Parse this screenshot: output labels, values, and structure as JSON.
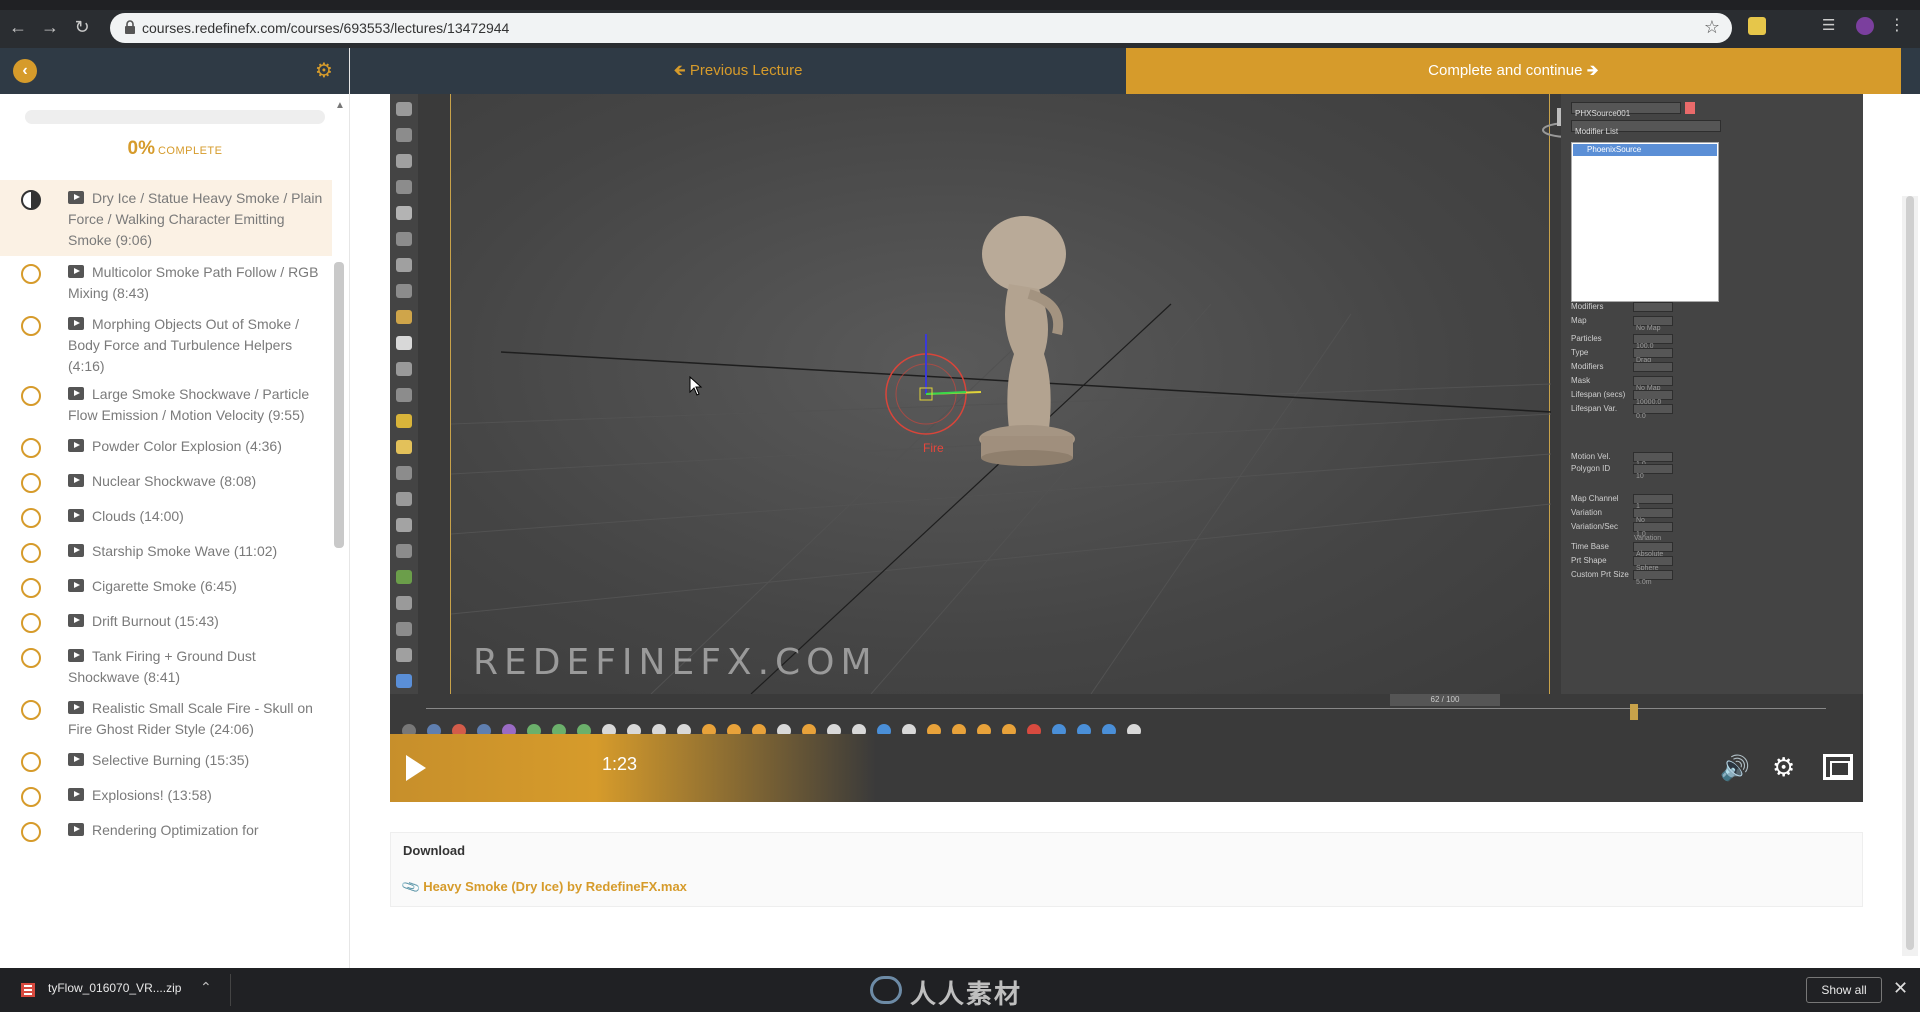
{
  "browser": {
    "url": "courses.redefinefx.com/courses/693553/lectures/13472944"
  },
  "sidebar": {
    "progress_percent": "0%",
    "progress_word": "COMPLETE",
    "progress_value": 0,
    "lectures": [
      {
        "title": "Dry Ice / Statue Heavy Smoke / Plain Force / Walking Character Emitting Smoke (9:06)",
        "status": "current"
      },
      {
        "title": "Multicolor Smoke Path Follow / RGB Mixing (8:43)",
        "status": "incomplete"
      },
      {
        "title": "Morphing Objects Out of Smoke / Body Force and Turbulence Helpers (4:16)",
        "status": "incomplete"
      },
      {
        "title": "Large Smoke Shockwave / Particle Flow Emission / Motion Velocity (9:55)",
        "status": "incomplete"
      },
      {
        "title": "Powder Color Explosion (4:36)",
        "status": "incomplete"
      },
      {
        "title": "Nuclear Shockwave (8:08)",
        "status": "incomplete"
      },
      {
        "title": "Clouds (14:00)",
        "status": "incomplete"
      },
      {
        "title": "Starship Smoke Wave (11:02)",
        "status": "incomplete"
      },
      {
        "title": "Cigarette Smoke (6:45)",
        "status": "incomplete"
      },
      {
        "title": "Drift Burnout (15:43)",
        "status": "incomplete"
      },
      {
        "title": "Tank Firing + Ground Dust Shockwave (8:41)",
        "status": "incomplete"
      },
      {
        "title": "Realistic Small Scale Fire - Skull on Fire Ghost Rider Style (24:06)",
        "status": "incomplete"
      },
      {
        "title": "Selective Burning (15:35)",
        "status": "incomplete"
      },
      {
        "title": "Explosions! (13:58)",
        "status": "incomplete"
      },
      {
        "title": "Rendering Optimization for",
        "status": "incomplete"
      }
    ]
  },
  "course_nav": {
    "previous_label": "Previous Lecture",
    "complete_label": "Complete and continue"
  },
  "video": {
    "watermark": "REDEFINEFX.COM",
    "time": "1:23",
    "fire_label": "Fire",
    "frame_indicator": "62 / 100",
    "panel": {
      "object_name": "PHXSource001",
      "modifier_list": "Modifier List",
      "selected_modifier": "PhoenixSource",
      "rows": [
        {
          "label": "Modifiers",
          "value": ""
        },
        {
          "label": "Map",
          "value": "No Map"
        },
        {
          "label": "Particles",
          "value": "100.0"
        },
        {
          "label": "Type",
          "value": "Drag"
        },
        {
          "label": "Modifiers",
          "value": ""
        },
        {
          "label": "Mask",
          "value": "No Map"
        },
        {
          "label": "Lifespan (secs)",
          "value": "10000.0"
        },
        {
          "label": "Lifespan Var.",
          "value": "0.0"
        },
        {
          "label": "Motion Vel.",
          "value": "1.0"
        },
        {
          "label": "Polygon ID",
          "value": "10"
        },
        {
          "label": "Map Channel",
          "value": "1"
        },
        {
          "label": "Variation",
          "value": "No Variation"
        },
        {
          "label": "Variation/Sec",
          "value": "1.0"
        },
        {
          "label": "Time Base",
          "value": "Absolute"
        },
        {
          "label": "Prt Shape",
          "value": "Sphere"
        },
        {
          "label": "Custom Prt Size",
          "value": "5.0m"
        }
      ]
    }
  },
  "download": {
    "title": "Download",
    "file": "Heavy Smoke (Dry Ice) by RedefineFX.max"
  },
  "download_bar": {
    "filename": "tyFlow_016070_VR....zip",
    "show_all": "Show all",
    "logo": "人人素材"
  },
  "colors": {
    "accent": "#d69b2b",
    "nav_dark": "#2f3a45",
    "browser_dark": "#2a2d31"
  }
}
